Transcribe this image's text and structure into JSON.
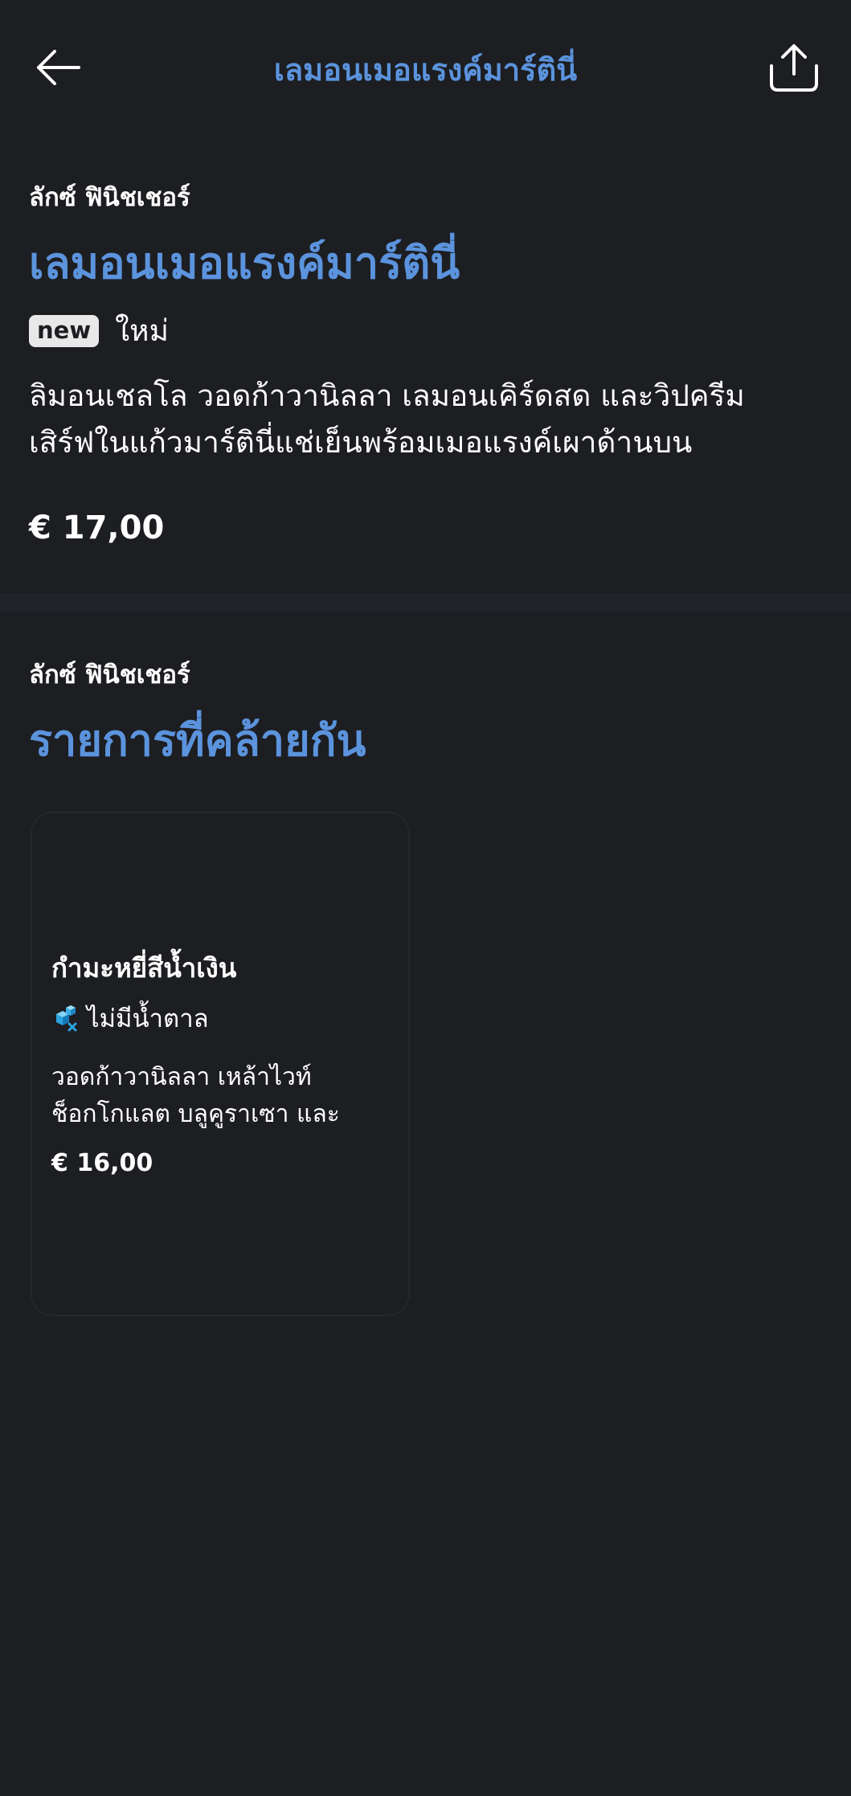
{
  "header": {
    "title": "เลมอนเมอแรงค์มาร์ตินี่",
    "back_icon": "arrow-left-icon",
    "share_icon": "share-icon"
  },
  "product": {
    "brand": "ลักซ์ ฟินิชเชอร์",
    "name": "เลมอนเมอแรงค์มาร์ตินี่",
    "badge": "new",
    "badge_label": "ใหม่",
    "description_line1": "ลิมอนเชลโล วอดก้าวานิลลา เลมอนเคิร์ดสด และวิปครีม",
    "description_line2": "เสิร์ฟในแก้วมาร์ตินี่แช่เย็นพร้อมเมอแรงค์เผาด้านบน",
    "price": "€ 17,00"
  },
  "similar": {
    "brand": "ลักซ์ ฟินิชเชอร์",
    "title": "รายการที่คล้ายกัน",
    "items": [
      {
        "name": "กำมะหยี่สีน้ำเงิน",
        "tag_icon": "no-sugar-icon",
        "tag_label": "ไม่มีน้ำตาล",
        "description_line1": "วอดก้าวานิลลา เหล้าไวท์",
        "description_line2": "ช็อกโกแลต บลูคูราเซา และครีม...",
        "price": "€ 16,00"
      }
    ]
  },
  "colors": {
    "background": "#1d1e22",
    "accent": "#5b93dd",
    "badge_bg": "#e8e8e8",
    "divider": "#202329"
  }
}
